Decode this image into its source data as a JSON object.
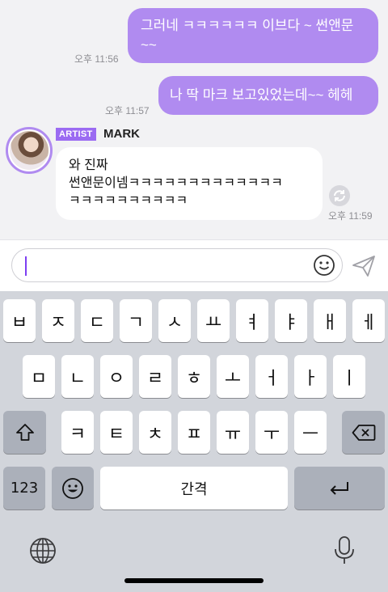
{
  "messages": [
    {
      "from": "me",
      "text": "그러네 ㅋㅋㅋㅋㅋㅋ 이브다 ~ 썬앤문 ~~",
      "time": "오후 11:56"
    },
    {
      "from": "me",
      "text": "나 딱 마크 보고있었는데~~ 헤헤",
      "time": "오후 11:57"
    },
    {
      "from": "artist",
      "badge": "ARTIST",
      "sender": "MARK",
      "lines": [
        "와 진짜",
        "썬앤문이넴ㅋㅋㅋㅋㅋㅋㅋㅋㅋㅋㅋㅋㅋ",
        "ㅋㅋㅋㅋㅋㅋㅋㅋㅋㅋ"
      ],
      "time": "오후 11:59"
    }
  ],
  "input": {
    "value": ""
  },
  "keyboard": {
    "row1": [
      "ㅂ",
      "ㅈ",
      "ㄷ",
      "ㄱ",
      "ㅅ",
      "ㅛ",
      "ㅕ",
      "ㅑ",
      "ㅐ",
      "ㅔ"
    ],
    "row2": [
      "ㅁ",
      "ㄴ",
      "ㅇ",
      "ㄹ",
      "ㅎ",
      "ㅗ",
      "ㅓ",
      "ㅏ",
      "ㅣ"
    ],
    "row3": [
      "ㅋ",
      "ㅌ",
      "ㅊ",
      "ㅍ",
      "ㅠ",
      "ㅜ",
      "ㅡ"
    ],
    "numbers_label": "123",
    "space_label": "간격"
  },
  "colors": {
    "accent": "#b08bf0",
    "badge": "#9b6bf2",
    "caret": "#7d3ff2"
  }
}
